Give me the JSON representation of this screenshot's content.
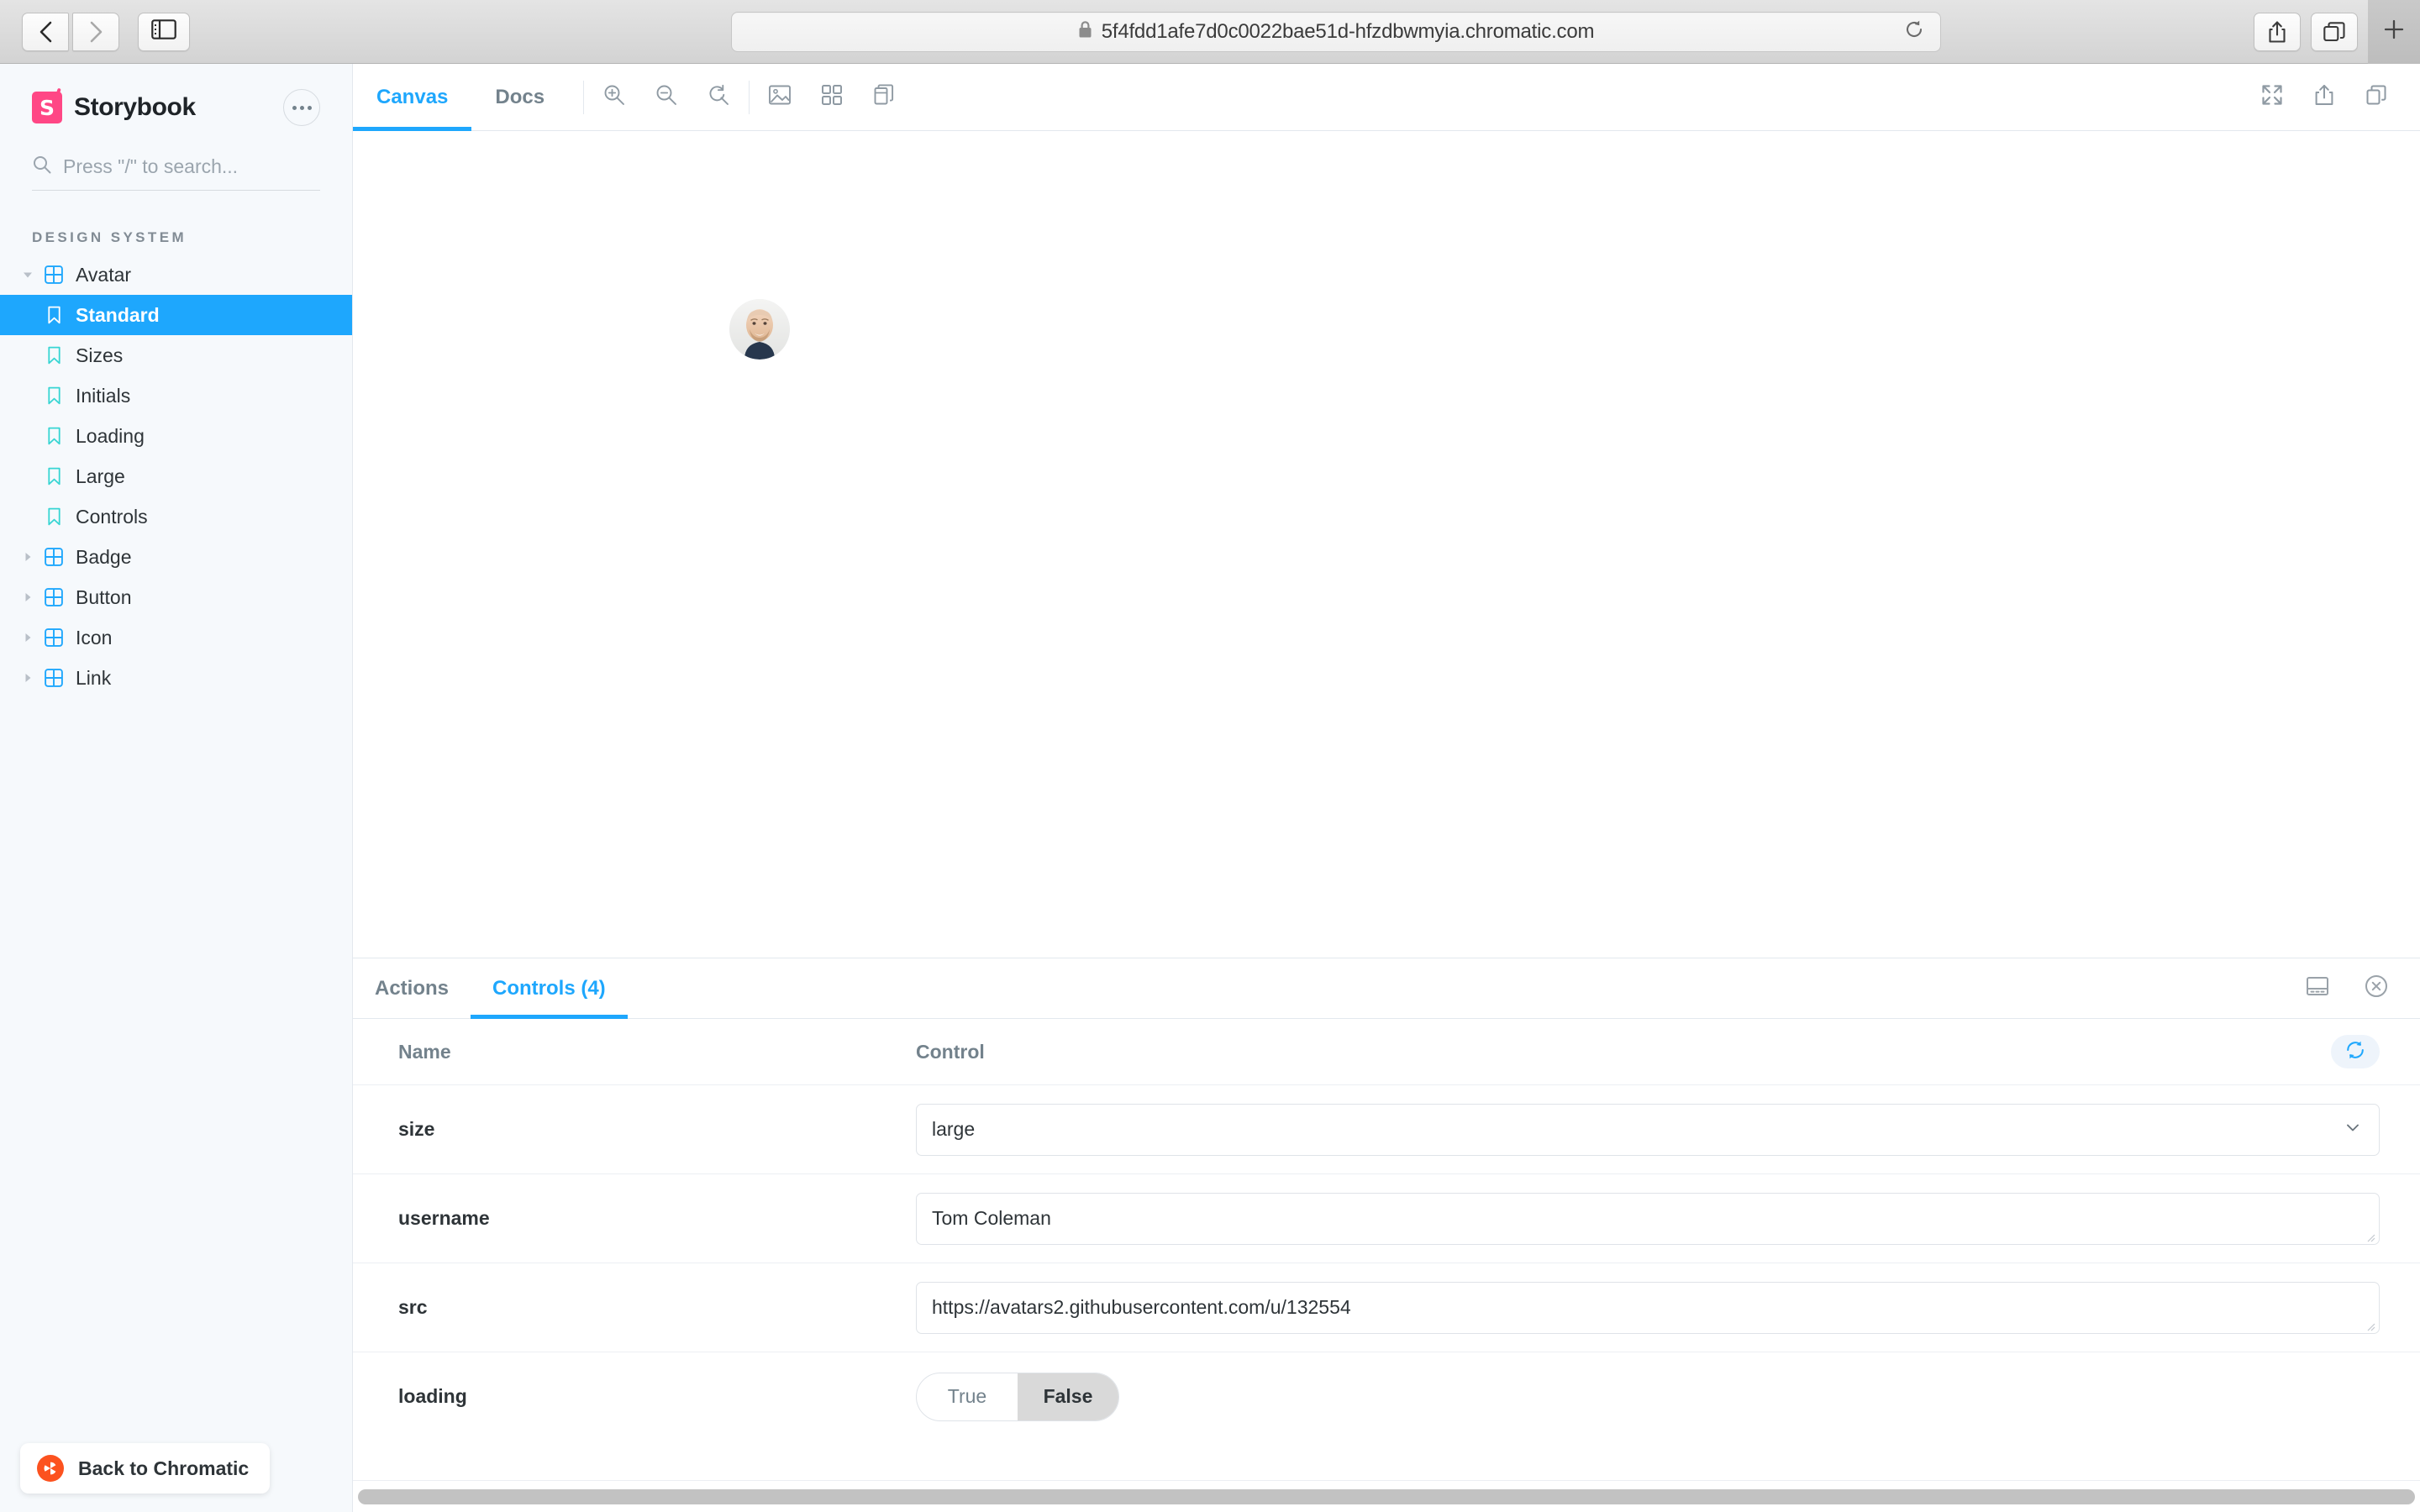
{
  "browser": {
    "url": "5f4fdd1afe7d0c0022bae51d-hfzdbwmyia.chromatic.com",
    "back_icon": "chevron-left-icon",
    "forward_icon": "chevron-right-icon",
    "sidebar_toggle_icon": "sidebar-toggle-icon",
    "lock_icon": "lock-icon",
    "reload_icon": "reload-icon",
    "share_icon": "share-icon",
    "tabs_icon": "tabs-overview-icon",
    "new_tab_icon": "plus-icon"
  },
  "sidebar": {
    "brand": "Storybook",
    "logo_icon": "storybook-logo-icon",
    "menu_icon": "ellipsis-icon",
    "search": {
      "placeholder": "Press \"/\" to search...",
      "value": "",
      "icon": "search-icon"
    },
    "section_title": "DESIGN SYSTEM",
    "tree": [
      {
        "label": "Avatar",
        "type": "component",
        "expanded": true,
        "selected": false,
        "icon": "component-grid-icon"
      },
      {
        "label": "Standard",
        "type": "story",
        "selected": true,
        "icon": "bookmark-icon"
      },
      {
        "label": "Sizes",
        "type": "story",
        "selected": false,
        "icon": "bookmark-icon"
      },
      {
        "label": "Initials",
        "type": "story",
        "selected": false,
        "icon": "bookmark-icon"
      },
      {
        "label": "Loading",
        "type": "story",
        "selected": false,
        "icon": "bookmark-icon"
      },
      {
        "label": "Large",
        "type": "story",
        "selected": false,
        "icon": "bookmark-icon"
      },
      {
        "label": "Controls",
        "type": "story",
        "selected": false,
        "icon": "bookmark-icon"
      },
      {
        "label": "Badge",
        "type": "component",
        "expanded": false,
        "selected": false,
        "icon": "component-grid-icon"
      },
      {
        "label": "Button",
        "type": "component",
        "expanded": false,
        "selected": false,
        "icon": "component-grid-icon"
      },
      {
        "label": "Icon",
        "type": "component",
        "expanded": false,
        "selected": false,
        "icon": "component-grid-icon"
      },
      {
        "label": "Link",
        "type": "component",
        "expanded": false,
        "selected": false,
        "icon": "component-grid-icon"
      }
    ],
    "back_to_chromatic": {
      "label": "Back to Chromatic",
      "icon": "chromatic-logo-icon",
      "color": "#fc521f"
    }
  },
  "toolbar": {
    "tabs": [
      {
        "label": "Canvas",
        "active": true
      },
      {
        "label": "Docs",
        "active": false
      }
    ],
    "icons": [
      {
        "name": "zoom-in-icon"
      },
      {
        "name": "zoom-out-icon"
      },
      {
        "name": "zoom-reset-icon"
      },
      {
        "name": "background-image-icon"
      },
      {
        "name": "grid-icon"
      },
      {
        "name": "measure-icon"
      }
    ],
    "right_icons": [
      {
        "name": "fullscreen-icon"
      },
      {
        "name": "open-in-new-tab-icon"
      },
      {
        "name": "copy-link-icon"
      }
    ]
  },
  "preview": {
    "story_name": "Standard",
    "avatar_alt": "Tom Coleman avatar"
  },
  "addons": {
    "tabs": [
      {
        "label": "Actions",
        "active": false
      },
      {
        "label": "Controls (4)",
        "active": true
      }
    ],
    "panel_position_icon": "panel-position-icon",
    "close_icon": "close-circle-icon",
    "reset_icon": "reset-controls-icon",
    "columns": {
      "name": "Name",
      "control": "Control"
    },
    "rows": [
      {
        "name": "size",
        "type": "select",
        "value": "large",
        "chevron_icon": "chevron-down-icon"
      },
      {
        "name": "username",
        "type": "textarea",
        "value": "Tom Coleman"
      },
      {
        "name": "src",
        "type": "textarea",
        "value": "https://avatars2.githubusercontent.com/u/132554"
      },
      {
        "name": "loading",
        "type": "boolean",
        "options": [
          "True",
          "False"
        ],
        "value": "False"
      }
    ]
  },
  "colors": {
    "accent_blue": "#1ea7fd",
    "storybook_pink": "#ff4785",
    "chromatic_orange": "#fc521f",
    "story_icon_teal": "#37d5d3",
    "component_icon_blue": "#1ea7fd",
    "sidebar_bg": "#f6f9fc",
    "text_primary": "#2e3438",
    "text_secondary": "#73828c"
  }
}
